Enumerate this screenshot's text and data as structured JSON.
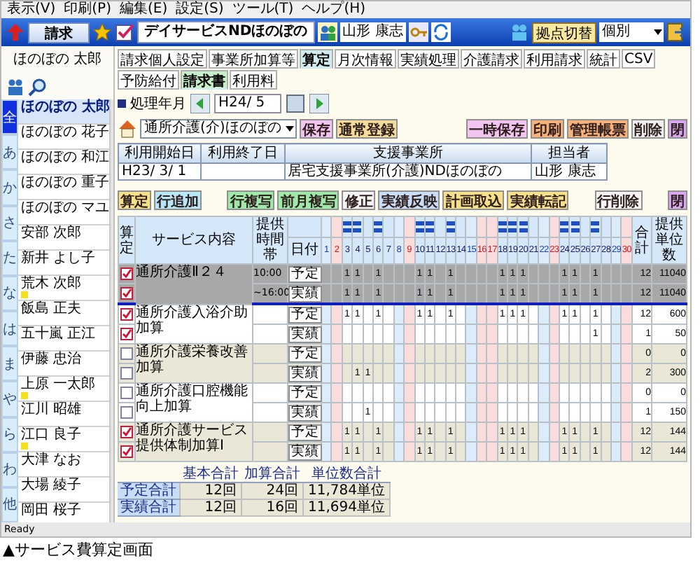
{
  "menu": [
    "表示(V)",
    "印刷(P)",
    "編集(E)",
    "設定(S)",
    "ツール(T)",
    "ヘルプ(H)"
  ],
  "toolbar": {
    "claim_button": "請求",
    "office_title": "デイサービスNDほのぼの",
    "staff_name": "山形 康志",
    "switch_button": "拠点切替",
    "base_select": "個別"
  },
  "client": {
    "name": "ほのぼの 太郎"
  },
  "kana_tabs": [
    {
      "label": "全",
      "selected": true
    },
    {
      "label": "あ",
      "selected": false
    },
    {
      "label": "か",
      "selected": false
    },
    {
      "label": "さ",
      "selected": false
    },
    {
      "label": "た",
      "selected": false
    },
    {
      "label": "な",
      "selected": false
    },
    {
      "label": "は",
      "selected": false
    },
    {
      "label": "ま",
      "selected": false
    },
    {
      "label": "や",
      "selected": false
    },
    {
      "label": "ら",
      "selected": false
    },
    {
      "label": "わ",
      "selected": false
    },
    {
      "label": "他",
      "selected": false
    }
  ],
  "clients": [
    {
      "name": "ほのぼの 太郎",
      "selected": true,
      "flag": false
    },
    {
      "name": "ほのぼの 花子",
      "selected": false,
      "flag": false
    },
    {
      "name": "ほのぼの 和江",
      "selected": false,
      "flag": false
    },
    {
      "name": "ほのぼの 重子",
      "selected": false,
      "flag": false
    },
    {
      "name": "ほのぼの マユ",
      "selected": false,
      "flag": false
    },
    {
      "name": "安部 次郎",
      "selected": false,
      "flag": false
    },
    {
      "name": "新井 よし子",
      "selected": false,
      "flag": false
    },
    {
      "name": "荒木 次郎",
      "selected": false,
      "flag": true
    },
    {
      "name": "飯島 正夫",
      "selected": false,
      "flag": false
    },
    {
      "name": "五十嵐 正江",
      "selected": false,
      "flag": false
    },
    {
      "name": "伊藤 忠治",
      "selected": false,
      "flag": false
    },
    {
      "name": "上原 一太郎",
      "selected": false,
      "flag": true
    },
    {
      "name": "江川 昭雄",
      "selected": false,
      "flag": false
    },
    {
      "name": "江口 良子",
      "selected": false,
      "flag": true
    },
    {
      "name": "大津 なお",
      "selected": false,
      "flag": false
    },
    {
      "name": "大場 綾子",
      "selected": false,
      "flag": false
    },
    {
      "name": "岡田 桜子",
      "selected": false,
      "flag": false
    }
  ],
  "tabs": [
    {
      "label": "請求個人設定",
      "selected": false
    },
    {
      "label": "事業所加算等",
      "selected": false
    },
    {
      "label": "算定",
      "selected": true
    },
    {
      "label": "月次情報",
      "selected": false
    },
    {
      "label": "実績処理",
      "selected": false
    },
    {
      "label": "介護請求",
      "selected": false
    },
    {
      "label": "利用請求",
      "selected": false
    },
    {
      "label": "統計",
      "selected": false
    },
    {
      "label": "CSV",
      "selected": false
    }
  ],
  "subtabs": [
    {
      "label": "予防給付",
      "selected": false
    },
    {
      "label": "請求書",
      "selected": true
    },
    {
      "label": "利用料",
      "selected": false
    }
  ],
  "period": {
    "label": "処理年月",
    "value": "H24/ 5"
  },
  "office": {
    "select": "通所介護(介)ほのぼの",
    "left_buttons": [
      {
        "label": "保存",
        "color": "#f2c6f0"
      },
      {
        "label": "通常登録",
        "color": "#f5dc9a"
      }
    ],
    "right_buttons": [
      {
        "label": "一時保存",
        "color": "#f2c6f0"
      },
      {
        "label": "印刷",
        "color": "#f7b27a"
      },
      {
        "label": "管理帳票",
        "color": "#f7b27a"
      },
      {
        "label": "削除",
        "color": "#eeeeee"
      },
      {
        "label": "閉",
        "color": "#d9a8f0"
      }
    ]
  },
  "info_table": {
    "columns": [
      "利用開始日",
      "利用終了日",
      "支援事業所",
      "担当者"
    ],
    "rows": [
      [
        "H23/ 3/ 1",
        null,
        "居宅支援事業所(介護)NDほのぼの",
        "山形 康志"
      ]
    ]
  },
  "action_groups": [
    [
      {
        "label": "算定",
        "color": "#f7e08a"
      },
      {
        "label": "行追加",
        "color": "#b8e8f8"
      }
    ],
    [
      {
        "label": "行複写",
        "color": "#9ee8a8"
      },
      {
        "label": "前月複写",
        "color": "#9ee8a8"
      },
      {
        "label": "修正",
        "color": "#f4f4f4"
      },
      {
        "label": "実績反映",
        "color": "#c8def8"
      },
      {
        "label": "計画取込",
        "color": "#f7e08a"
      },
      {
        "label": "実績転記",
        "color": "#f7e08a"
      }
    ],
    [
      {
        "label": "行削除",
        "color": "#f4f4f4"
      }
    ],
    [
      {
        "label": "閉",
        "color": "#d9a8f0"
      }
    ]
  ],
  "grid": {
    "headers": {
      "check": "算定",
      "service": "サービス内容",
      "time": "提供時間帯",
      "date": "日付",
      "total": "合計",
      "units": "提供単位数"
    },
    "days": [
      {
        "day": "1",
        "kind": "saturday",
        "planned": false
      },
      {
        "day": "2",
        "kind": "holiday",
        "planned": false
      },
      {
        "day": "3",
        "kind": "weekday",
        "planned": true
      },
      {
        "day": "4",
        "kind": "weekday",
        "planned": true
      },
      {
        "day": "5",
        "kind": "weekday",
        "planned": false
      },
      {
        "day": "6",
        "kind": "weekday",
        "planned": true
      },
      {
        "day": "7",
        "kind": "weekday",
        "planned": false
      },
      {
        "day": "8",
        "kind": "saturday",
        "planned": false
      },
      {
        "day": "9",
        "kind": "holiday",
        "planned": false
      },
      {
        "day": "10",
        "kind": "weekday",
        "planned": true
      },
      {
        "day": "11",
        "kind": "weekday",
        "planned": true
      },
      {
        "day": "12",
        "kind": "weekday",
        "planned": false
      },
      {
        "day": "13",
        "kind": "weekday",
        "planned": true
      },
      {
        "day": "14",
        "kind": "weekday",
        "planned": false
      },
      {
        "day": "15",
        "kind": "saturday",
        "planned": false
      },
      {
        "day": "16",
        "kind": "holiday",
        "planned": false
      },
      {
        "day": "17",
        "kind": "holiday",
        "planned": false
      },
      {
        "day": "18",
        "kind": "weekday",
        "planned": true
      },
      {
        "day": "19",
        "kind": "weekday",
        "planned": true
      },
      {
        "day": "20",
        "kind": "weekday",
        "planned": true
      },
      {
        "day": "21",
        "kind": "weekday",
        "planned": false
      },
      {
        "day": "22",
        "kind": "saturday",
        "planned": false
      },
      {
        "day": "23",
        "kind": "holiday",
        "planned": false
      },
      {
        "day": "24",
        "kind": "weekday",
        "planned": true
      },
      {
        "day": "25",
        "kind": "weekday",
        "planned": true
      },
      {
        "day": "26",
        "kind": "weekday",
        "planned": false
      },
      {
        "day": "27",
        "kind": "weekday",
        "planned": true
      },
      {
        "day": "28",
        "kind": "weekday",
        "planned": false
      },
      {
        "day": "29",
        "kind": "saturday",
        "planned": false
      },
      {
        "day": "30",
        "kind": "holiday",
        "planned": false
      }
    ],
    "services": [
      {
        "name": "通所介護Ⅱ２４",
        "selected": true,
        "rows": [
          {
            "time": "10:00",
            "label": "予定",
            "checked": true,
            "cells": [
              null,
              null,
              "1",
              "1",
              null,
              "1",
              null,
              null,
              null,
              "1",
              "1",
              null,
              "1",
              null,
              null,
              null,
              null,
              "1",
              "1",
              "1",
              null,
              null,
              null,
              "1",
              "1",
              null,
              "1",
              null,
              null,
              null
            ],
            "total": "12",
            "units": "11040"
          },
          {
            "time": "~16:00",
            "label": "実績",
            "checked": true,
            "cells": [
              null,
              null,
              "1",
              "1",
              null,
              "1",
              null,
              null,
              null,
              "1",
              "1",
              null,
              "1",
              null,
              null,
              null,
              null,
              "1",
              "1",
              "1",
              null,
              null,
              null,
              "1",
              "1",
              null,
              "1",
              null,
              null,
              null
            ],
            "total": "12",
            "units": "11040"
          }
        ]
      },
      {
        "name": "通所介護入浴介助加算",
        "selected": false,
        "rows": [
          {
            "label": "予定",
            "checked": true,
            "cells": [
              null,
              null,
              "1",
              "1",
              null,
              "1",
              null,
              null,
              null,
              "1",
              "1",
              null,
              "1",
              null,
              null,
              null,
              null,
              "1",
              "1",
              "1",
              null,
              null,
              null,
              "1",
              "1",
              null,
              "1",
              null,
              null,
              null
            ],
            "total": "12",
            "units": "600"
          },
          {
            "label": "実績",
            "checked": true,
            "cells": [
              null,
              null,
              null,
              null,
              null,
              null,
              null,
              null,
              null,
              null,
              null,
              null,
              null,
              null,
              null,
              null,
              null,
              null,
              null,
              null,
              null,
              null,
              null,
              null,
              null,
              null,
              "1",
              null,
              null,
              null
            ],
            "total": "1",
            "units": "50"
          }
        ]
      },
      {
        "name": "通所介護栄養改善加算",
        "selected": false,
        "rows": [
          {
            "label": "予定",
            "checked": false,
            "cells": [
              null,
              null,
              null,
              null,
              null,
              null,
              null,
              null,
              null,
              null,
              null,
              null,
              null,
              null,
              null,
              null,
              null,
              null,
              null,
              null,
              null,
              null,
              null,
              null,
              null,
              null,
              null,
              null,
              null,
              null
            ],
            "total": "0",
            "units": "0"
          },
          {
            "label": "実績",
            "checked": false,
            "cells": [
              null,
              null,
              null,
              "1",
              "1",
              null,
              null,
              null,
              null,
              null,
              null,
              null,
              null,
              null,
              null,
              null,
              null,
              null,
              null,
              null,
              null,
              null,
              null,
              null,
              null,
              null,
              null,
              null,
              null,
              null
            ],
            "total": "2",
            "units": "300"
          }
        ]
      },
      {
        "name": "通所介護口腔機能向上加算",
        "selected": false,
        "rows": [
          {
            "label": "予定",
            "checked": false,
            "cells": [
              null,
              null,
              null,
              null,
              null,
              null,
              null,
              null,
              null,
              null,
              null,
              null,
              null,
              null,
              null,
              null,
              null,
              null,
              null,
              null,
              null,
              null,
              null,
              null,
              null,
              null,
              null,
              null,
              null,
              null
            ],
            "total": "0",
            "units": "0"
          },
          {
            "label": "実績",
            "checked": false,
            "cells": [
              null,
              null,
              null,
              null,
              "1",
              null,
              null,
              null,
              null,
              null,
              null,
              null,
              null,
              null,
              null,
              null,
              null,
              null,
              null,
              null,
              null,
              null,
              null,
              null,
              null,
              null,
              null,
              null,
              null,
              null
            ],
            "total": "1",
            "units": "150"
          }
        ]
      },
      {
        "name": "通所介護サービス提供体制加算Ⅰ",
        "selected": false,
        "rows": [
          {
            "label": "予定",
            "checked": true,
            "cells": [
              null,
              null,
              "1",
              "1",
              null,
              "1",
              null,
              null,
              null,
              "1",
              "1",
              null,
              "1",
              null,
              null,
              null,
              null,
              "1",
              "1",
              "1",
              null,
              null,
              null,
              "1",
              "1",
              null,
              "1",
              null,
              null,
              null
            ],
            "total": "12",
            "units": "144"
          },
          {
            "label": "実績",
            "checked": true,
            "cells": [
              null,
              null,
              "1",
              "1",
              null,
              "1",
              null,
              null,
              null,
              "1",
              "1",
              null,
              "1",
              null,
              null,
              null,
              null,
              "1",
              "1",
              "1",
              null,
              null,
              null,
              "1",
              "1",
              null,
              "1",
              null,
              null,
              null
            ],
            "total": "12",
            "units": "144"
          }
        ]
      }
    ]
  },
  "summary": {
    "columns": [
      "基本合計",
      "加算合計",
      "単位数合計"
    ],
    "rows": [
      {
        "label": "予定合計",
        "values": [
          "12回",
          "24回",
          "11,784単位"
        ]
      },
      {
        "label": "実績合計",
        "values": [
          "12回",
          "16回",
          "11,694単位"
        ]
      }
    ]
  },
  "status_bar": "Ready",
  "caption": "▲サービス費算定画面"
}
